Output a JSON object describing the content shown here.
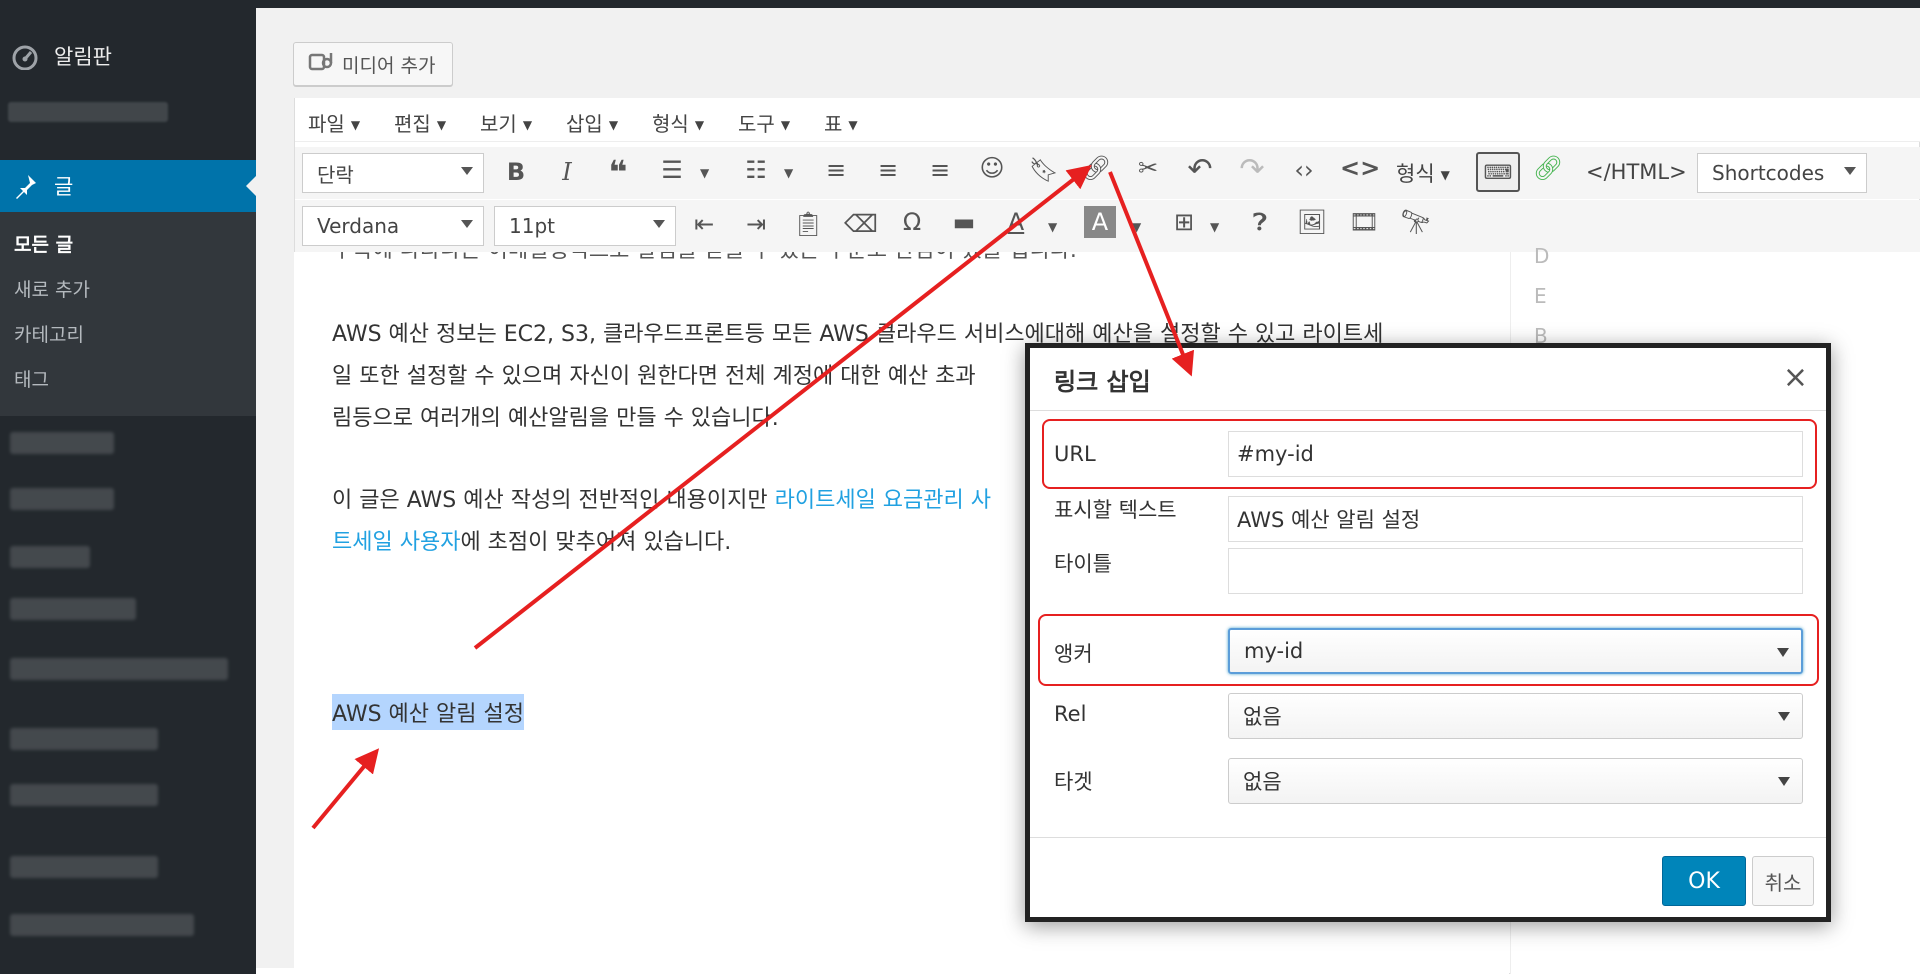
{
  "sidebar": {
    "dashboard_label": "알림판",
    "posts_label": "글",
    "submenu": [
      "모든 글",
      "새로 추가",
      "카테고리",
      "태그"
    ]
  },
  "editor": {
    "media_button": "미디어 추가",
    "menus": [
      "파일",
      "편집",
      "보기",
      "삽입",
      "형식",
      "도구",
      "표"
    ],
    "toolbar": {
      "paragraph_select": "단락",
      "format_label": "형식",
      "html_label": "</HTML>",
      "shortcodes_select": "Shortcodes",
      "font_select": "Verdana",
      "size_select": "11pt"
    },
    "content": {
      "line_cut": "우측에 나타나는 이메일형식으로 알림을 받을 수 있는 부분도 관심이 있을 겁니다.",
      "p1_line1": "AWS 예산 정보는  EC2, S3, 클라우드프론트등 모든 AWS 클라우드 서비스에대해 예산을 설정할 수 있고 라이트세",
      "p1_line2": "일 또한 설정할 수 있으며 자신이 원한다면 전체 계정에 대한 예산 초과",
      "p1_line3": "림등으로 여러개의 예산알림을 만들 수 있습니다.",
      "p2_line1_prefix": "이 글은 AWS 예산 작성의 전반적인 내용이지만 ",
      "p2_link1": "라이트세일 요금관리 사",
      "p2_link2": "트세일 사용자",
      "p2_line2_suffix": "에 초점이 맞추어져 있습니다.",
      "selected": "AWS 예산 알림 설정"
    },
    "gutter_letters": [
      "D",
      "E",
      "B"
    ]
  },
  "dialog": {
    "title": "링크 삽입",
    "close": "×",
    "fields": {
      "url_label": "URL",
      "url_value": "#my-id",
      "text_label": "표시할 텍스트",
      "text_value": "AWS 예산 알림 설정",
      "title_label": "타이틀",
      "title_value": "",
      "anchor_label": "앵커",
      "anchor_value": "my-id",
      "rel_label": "Rel",
      "rel_value": "없음",
      "target_label": "타겟",
      "target_value": "없음"
    },
    "ok": "OK",
    "cancel": "취소"
  },
  "colors": {
    "sidebar_bg": "#23282d",
    "accent": "#0073aa",
    "ok_button": "#0085ba",
    "annotation": "#e62020",
    "link": "#21a1e1",
    "selection": "#b4d5fe"
  },
  "icons": [
    "dashboard-icon",
    "pin-icon",
    "media-icon",
    "bold-icon",
    "italic-icon",
    "quote-icon",
    "bullet-list-icon",
    "numbered-list-icon",
    "align-left-icon",
    "align-center-icon",
    "align-right-icon",
    "emoji-icon",
    "bookmark-icon",
    "link-icon",
    "unlink-icon",
    "undo-icon",
    "redo-icon",
    "code-icon",
    "source-code-icon",
    "keyboard-icon",
    "green-link-icon",
    "outdent-icon",
    "indent-icon",
    "paste-icon",
    "eraser-icon",
    "omega-icon",
    "page-break-icon",
    "text-color-icon",
    "bg-color-icon",
    "table-icon",
    "help-icon",
    "image-icon",
    "video-icon",
    "find-icon"
  ]
}
